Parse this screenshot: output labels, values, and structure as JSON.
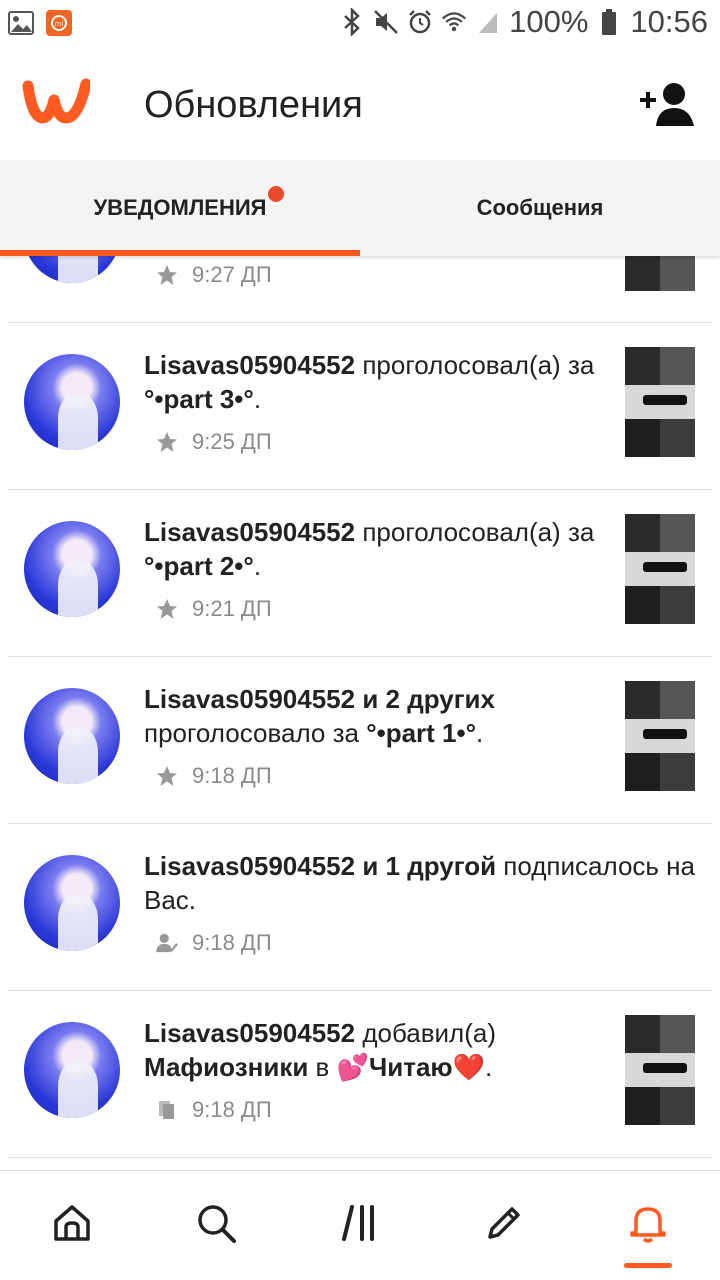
{
  "status_bar": {
    "battery": "100%",
    "time": "10:56",
    "icons": [
      "image-icon",
      "mi-icon",
      "bluetooth-icon",
      "mute-icon",
      "alarm-icon",
      "wifi-icon",
      "signal-icon",
      "battery-icon"
    ]
  },
  "header": {
    "title": "Обновления",
    "logo": "wattpad-logo",
    "action_icon": "add-user-icon"
  },
  "tabs": [
    {
      "label": "УВЕДОМЛЕНИЯ",
      "active": true,
      "has_dot": true
    },
    {
      "label": "Сообщения",
      "active": false
    }
  ],
  "notifications": [
    {
      "partial": true,
      "time": "9:27 ДП",
      "icon": "star-icon"
    },
    {
      "user": "Lisavas05904552",
      "action": " проголосовал(а) за ",
      "target": "°•part 3•°",
      "suffix": ".",
      "time": "9:25 ДП",
      "icon": "star-icon"
    },
    {
      "user": "Lisavas05904552",
      "action": " проголосовал(а) за ",
      "target": "°•part 2•°",
      "suffix": ".",
      "time": "9:21 ДП",
      "icon": "star-icon"
    },
    {
      "user": "Lisavas05904552",
      "others": " и 2 других",
      "action": " проголосовало за ",
      "target": "°•part 1•°",
      "suffix": ".",
      "time": "9:18 ДП",
      "icon": "star-icon"
    },
    {
      "user": "Lisavas05904552",
      "others": " и 1 другой",
      "action": " подписалось на Вас.",
      "time": "9:18 ДП",
      "icon": "follow-icon"
    },
    {
      "user": "Lisavas05904552",
      "action": " добавил(а) ",
      "target": "Мафиозники",
      "mid": " в ",
      "list": "💕Читаю❤️",
      "suffix": ".",
      "time": "9:18 ДП",
      "icon": "library-icon"
    }
  ],
  "bottom_nav": [
    {
      "name": "home",
      "icon": "home-icon"
    },
    {
      "name": "search",
      "icon": "search-icon"
    },
    {
      "name": "library",
      "icon": "library-icon"
    },
    {
      "name": "write",
      "icon": "pencil-icon"
    },
    {
      "name": "notifications",
      "icon": "bell-icon",
      "active": true
    }
  ],
  "colors": {
    "accent": "#ff5a1f",
    "notification_dot": "#ea4a2a",
    "meta_text": "#8a8a8a"
  }
}
